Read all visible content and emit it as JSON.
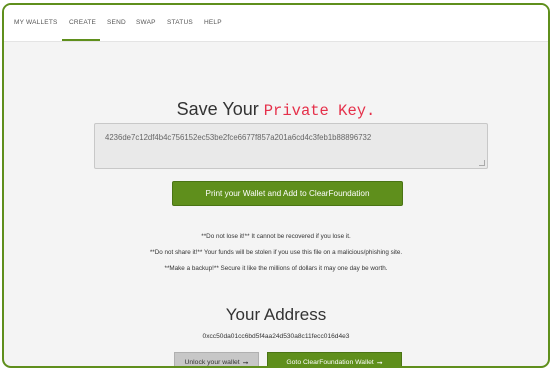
{
  "nav": {
    "tabs": [
      {
        "label": "MY WALLETS"
      },
      {
        "label": "CREATE",
        "active": true
      },
      {
        "label": "SEND"
      },
      {
        "label": "SWAP"
      },
      {
        "label": "STATUS"
      },
      {
        "label": "HELP"
      }
    ]
  },
  "main": {
    "heading_prefix": "Save Your",
    "heading_key": "Private Key.",
    "private_key": "4236de7c12df4b4c756152ec53be2fce6677f857a201a6cd4c3feb1b88896732",
    "print_button": "Print your Wallet and Add to ClearFoundation",
    "warnings": [
      "**Do not lose it!** It cannot be recovered if you lose it.",
      "**Do not share it!** Your funds will be stolen if you use this file on a malicious/phishing site.",
      "**Make a backup!** Secure it like the millions of dollars it may one day be worth."
    ],
    "address_heading": "Your Address",
    "address": "0xcc50da01cc6bd5f4aa24d530a8c11fecc016d4e3",
    "unlock_button": "Unlock your wallet",
    "goto_button": "Goto ClearFoundation Wallet",
    "arrow_glyph": "➞"
  },
  "colors": {
    "accent": "#5f8f1c",
    "key_text": "#e5304a",
    "background": "#f4f4f4"
  }
}
